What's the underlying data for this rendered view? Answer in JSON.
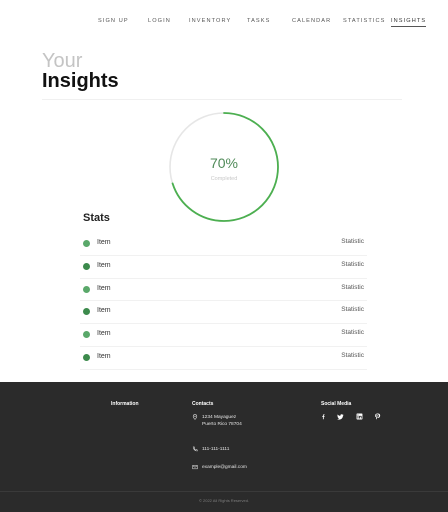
{
  "nav": {
    "items": [
      {
        "label": "SIGN UP"
      },
      {
        "label": "LOGIN"
      },
      {
        "label": "INVENTORY"
      },
      {
        "label": "TASKS"
      },
      {
        "label": "CALENDAR"
      },
      {
        "label": "STATISTICS"
      },
      {
        "label": "INSIGHTS",
        "active": true
      }
    ]
  },
  "hero": {
    "line1": "Your",
    "line2": "Insights"
  },
  "progress": {
    "percent": 70,
    "value_label": "70%",
    "caption": "Completed",
    "track_color": "#e6e6e6",
    "fill_color": "#4caf50"
  },
  "stats": {
    "title": "Stats",
    "rows": [
      {
        "item": "Item",
        "value": "Statistic",
        "dot_color": "#5aa86a"
      },
      {
        "item": "Item",
        "value": "Statistic",
        "dot_color": "#3c8a4c"
      },
      {
        "item": "Item",
        "value": "Statistic",
        "dot_color": "#5aa86a"
      },
      {
        "item": "Item",
        "value": "Statistic",
        "dot_color": "#3c8a4c"
      },
      {
        "item": "Item",
        "value": "Statistic",
        "dot_color": "#5aa86a"
      },
      {
        "item": "Item",
        "value": "Statistic",
        "dot_color": "#3c8a4c"
      }
    ]
  },
  "footer": {
    "information_heading": "Information",
    "contacts_heading": "Contacts",
    "address_line1": "1234 Mayaguez",
    "address_line2": "Puerto Rico 78704",
    "phone": "111-111-1111",
    "email": "example@gmail.com",
    "social_heading": "Social Media",
    "social_icons": [
      "facebook-icon",
      "twitter-icon",
      "linkedin-icon",
      "pinterest-icon"
    ],
    "copyright": "© 2022 All Rights Reserved."
  }
}
